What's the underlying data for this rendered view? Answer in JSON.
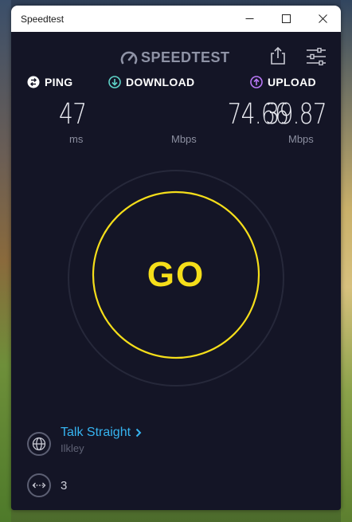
{
  "window": {
    "title": "Speedtest"
  },
  "header": {
    "logo_text": "SPEEDTEST",
    "share_icon": "share-icon",
    "settings_icon": "sliders-icon"
  },
  "metrics": {
    "ping": {
      "label": "PING",
      "value": "47",
      "unit": "ms"
    },
    "download": {
      "label": "DOWNLOAD",
      "value": "74.66",
      "unit": "Mbps"
    },
    "upload": {
      "label": "UPLOAD",
      "value": "39.87",
      "unit": "Mbps"
    }
  },
  "go": {
    "label": "GO"
  },
  "server": {
    "name": "Talk Straight",
    "location": "Ilkley"
  },
  "connections": {
    "count": "3"
  },
  "colors": {
    "accent": "#f5de1a",
    "link": "#36b4f0",
    "download": "#5fd3c8",
    "upload": "#b877f5",
    "background": "#141526"
  }
}
